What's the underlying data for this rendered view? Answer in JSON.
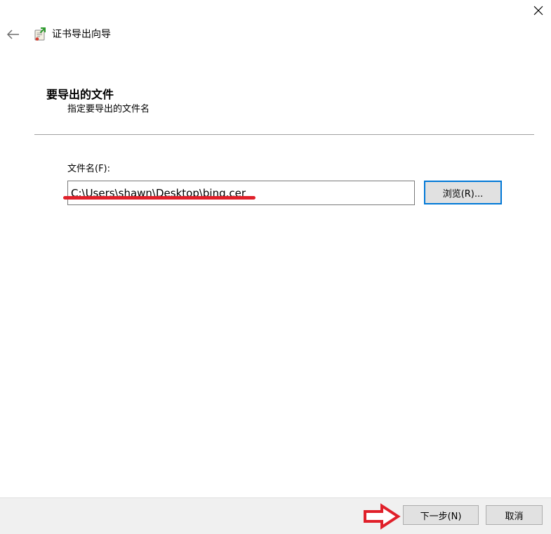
{
  "window": {
    "title": "证书导出向导",
    "back_icon": "back-arrow-icon",
    "close_icon": "close-icon",
    "wizard_icon": "certificate-export-icon"
  },
  "header": {
    "title": "要导出的文件",
    "subtitle": "指定要导出的文件名"
  },
  "form": {
    "file_label": "文件名(F):",
    "file_value": "C:\\Users\\shawn\\Desktop\\bing.cer",
    "browse_label": "浏览(R)..."
  },
  "annotations": {
    "underline_color": "#e0202a",
    "arrow_icon": "right-arrow-outline-icon",
    "arrow_color": "#e0202a"
  },
  "footer": {
    "next_label": "下一步(N)",
    "cancel_label": "取消"
  },
  "colors": {
    "accent": "#0078d7",
    "footer_bg": "#f0f0f0",
    "button_bg": "#e1e1e1"
  }
}
